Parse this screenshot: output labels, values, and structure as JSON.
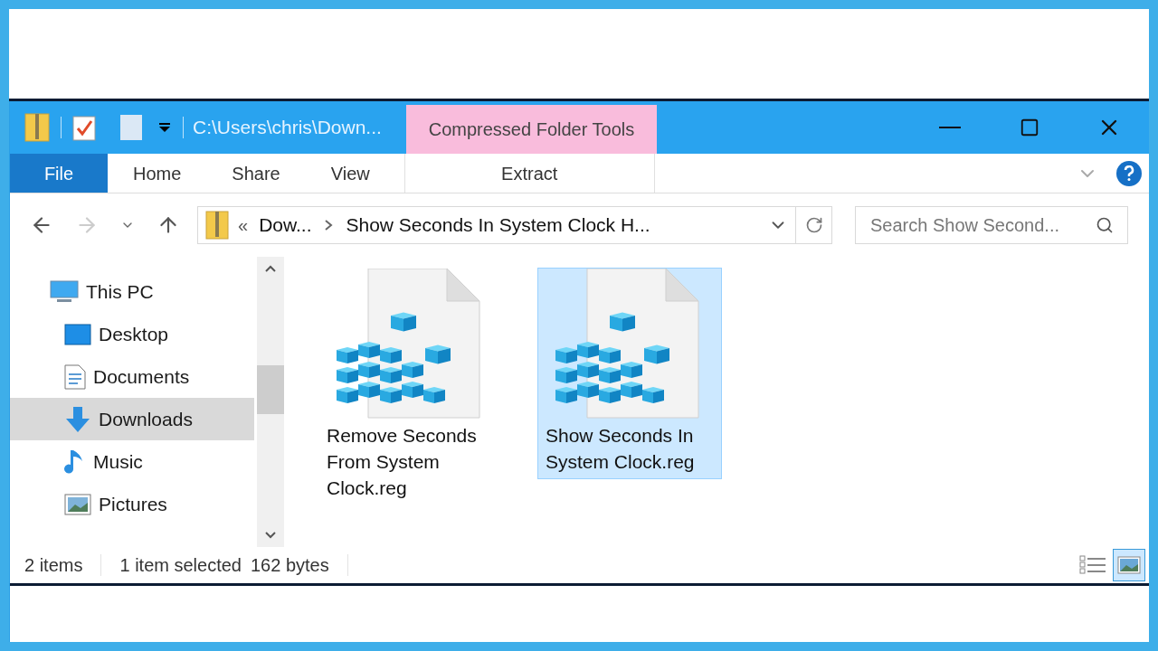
{
  "window": {
    "title": "C:\\Users\\chris\\Down..."
  },
  "contextual_tab": {
    "label": "Compressed Folder Tools"
  },
  "ribbon_tabs": [
    {
      "label": "File",
      "kind": "file-menu"
    },
    {
      "label": "Home",
      "kind": "tab"
    },
    {
      "label": "Share",
      "kind": "tab"
    },
    {
      "label": "View",
      "kind": "tab"
    },
    {
      "label": "Extract",
      "kind": "contextual"
    }
  ],
  "address": {
    "overflow": "«",
    "breadcrumbs": [
      "Dow...",
      "Show Seconds In System Clock H..."
    ]
  },
  "search": {
    "placeholder": "Search Show Second..."
  },
  "navigation": [
    {
      "label": "This PC",
      "kind": "pc",
      "selected": false,
      "children": [
        {
          "label": "Desktop",
          "kind": "desktop",
          "selected": false
        },
        {
          "label": "Documents",
          "kind": "documents",
          "selected": false
        },
        {
          "label": "Downloads",
          "kind": "downloads",
          "selected": true
        },
        {
          "label": "Music",
          "kind": "music",
          "selected": false
        },
        {
          "label": "Pictures",
          "kind": "pictures",
          "selected": false
        }
      ]
    }
  ],
  "files": [
    {
      "name": "Remove Seconds From System Clock.reg",
      "selected": false
    },
    {
      "name": "Show Seconds In System Clock.reg",
      "selected": true
    }
  ],
  "status_bar": {
    "item_count": "2 items",
    "selection": "1 item selected",
    "size": "162 bytes"
  },
  "view_buttons": [
    {
      "kind": "details",
      "selected": false
    },
    {
      "kind": "large-icons",
      "selected": true
    }
  ]
}
